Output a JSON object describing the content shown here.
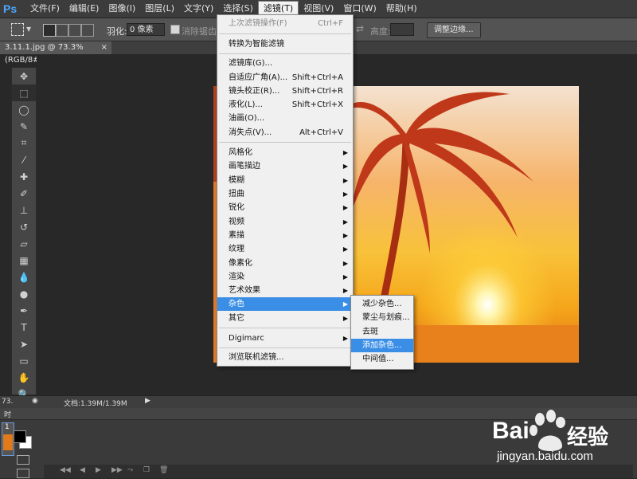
{
  "app": {
    "logo": "Ps"
  },
  "menubar": {
    "items": [
      "文件(F)",
      "编辑(E)",
      "图像(I)",
      "图层(L)",
      "文字(Y)",
      "选择(S)",
      "滤镜(T)",
      "视图(V)",
      "窗口(W)",
      "帮助(H)"
    ],
    "active_index": 6
  },
  "options": {
    "feather_label": "羽化:",
    "feather_value": "0 像素",
    "antialias_label": "消除锯齿",
    "height_label": "高度:",
    "refine_edge_button": "调整边缘..."
  },
  "document_tab": {
    "title": "3.11.1.jpg @ 73.3%(RGB/8#)",
    "close": "×"
  },
  "status": {
    "zoom": "73.",
    "doc_size": "文档:1.39M/1.39M"
  },
  "timeline": {
    "label": "时",
    "frame_number": "1"
  },
  "filter_menu": {
    "items": [
      {
        "label": "上次滤镜操作(F)",
        "shortcut": "Ctrl+F",
        "disabled": true
      },
      {
        "label": "转换为智能滤镜"
      },
      {
        "label": "滤镜库(G)..."
      },
      {
        "label": "自适应广角(A)...",
        "shortcut": "Shift+Ctrl+A"
      },
      {
        "label": "镜头校正(R)...",
        "shortcut": "Shift+Ctrl+R"
      },
      {
        "label": "液化(L)...",
        "shortcut": "Shift+Ctrl+X"
      },
      {
        "label": "油画(O)..."
      },
      {
        "label": "消失点(V)...",
        "shortcut": "Alt+Ctrl+V"
      },
      {
        "label": "风格化",
        "submenu": true
      },
      {
        "label": "画笔描边",
        "submenu": true
      },
      {
        "label": "模糊",
        "submenu": true
      },
      {
        "label": "扭曲",
        "submenu": true
      },
      {
        "label": "锐化",
        "submenu": true
      },
      {
        "label": "视频",
        "submenu": true
      },
      {
        "label": "素描",
        "submenu": true
      },
      {
        "label": "纹理",
        "submenu": true
      },
      {
        "label": "像素化",
        "submenu": true
      },
      {
        "label": "渲染",
        "submenu": true
      },
      {
        "label": "艺术效果",
        "submenu": true
      },
      {
        "label": "杂色",
        "submenu": true,
        "highlighted": true
      },
      {
        "label": "其它",
        "submenu": true
      },
      {
        "label": "Digimarc",
        "submenu": true
      },
      {
        "label": "浏览联机滤镜..."
      }
    ]
  },
  "noise_submenu": {
    "items": [
      {
        "label": "减少杂色..."
      },
      {
        "label": "蒙尘与划痕..."
      },
      {
        "label": "去斑"
      },
      {
        "label": "添加杂色...",
        "highlighted": true
      },
      {
        "label": "中间值..."
      }
    ]
  },
  "watermark": {
    "brand": "Bai",
    "brand_cn": "经验",
    "url": "jingyan.baidu.com"
  },
  "colors": {
    "highlight": "#3a8ee6",
    "menu_bg": "#f0f0f0",
    "ps_blue": "#4aa8ff"
  }
}
